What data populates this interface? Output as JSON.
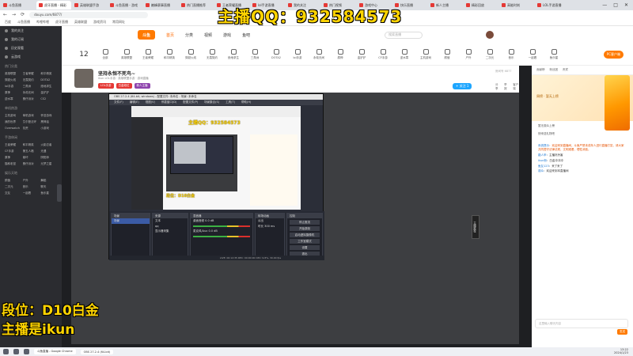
{
  "browser": {
    "tabs": [
      "斗鱼直播",
      "虎牙直播 - 精彩",
      "英雄联盟手游",
      "斗鱼直播 - 游戏",
      "巅峰赛事直播",
      "热门直播推荐",
      "王者荣耀直播",
      "lol手游直播",
      "我的关注",
      "热门视频",
      "游戏中心",
      "快乐直播",
      "新人主播",
      "精彩回放",
      "高能时刻",
      "LOL手游直播"
    ],
    "active_tab": 1,
    "url": "douyu.com/6877/",
    "bookmarks": [
      "百度",
      "斗鱼直播",
      "哔哩哔哩",
      "虎牙直播",
      "英雄联盟",
      "游戏资讯",
      "常用网址"
    ]
  },
  "overlay": {
    "qq": "主播QQ：932584573",
    "rank": "段位：D10白金",
    "host": "主播是ikun"
  },
  "sidebar": {
    "items": [
      "我的关注",
      "我的订阅",
      "历史观看",
      "云游戏"
    ],
    "sections": [
      {
        "title": "热门分类",
        "tags": [
          "英雄联盟",
          "王者荣耀",
          "和平精英",
          "穿越火线",
          "无畏契约",
          "DOTA2",
          "lol手游",
          "三角洲",
          "绝地求生",
          "原神",
          "永劫无间",
          "金铲铲",
          "逆水寒",
          "蛋仔派对",
          "CS2"
        ]
      },
      {
        "title": "单机热游",
        "tags": [
          "主机游戏",
          "单机游戏",
          "怀旧游戏",
          "我的世界",
          "艾尔登法环",
          "黑神话",
          "Overwatch",
          "饥荒",
          "小游戏"
        ]
      },
      {
        "title": "手游休闲",
        "tags": [
          "王者荣耀",
          "和平精英",
          "火影忍者",
          "CF手游",
          "第五人格",
          "光遇",
          "原神",
          "崩坏",
          "阴阳师",
          "猫和老鼠",
          "蛋仔派对",
          "元梦之星"
        ]
      },
      {
        "title": "娱乐天地",
        "tags": [
          "颜值",
          "户外",
          "舞蹈",
          "二次元",
          "音乐",
          "聊天",
          "交友",
          "一起看",
          "鱼乐星"
        ]
      }
    ]
  },
  "header": {
    "logo": "斗鱼",
    "nav": [
      "首页",
      "分类",
      "视频",
      "游戏",
      "鱼吧"
    ],
    "nav_active": 0,
    "search_placeholder": "搜索直播",
    "pc_client": "PC客户端"
  },
  "categories": {
    "count": "12",
    "items": [
      "全部",
      "英雄联盟",
      "王者荣耀",
      "和平精英",
      "穿越火线",
      "无畏契约",
      "绝地求生",
      "三角洲",
      "DOTA2",
      "lol手游",
      "永劫无间",
      "原神",
      "金铲铲",
      "CF手游",
      "逆水寒",
      "主机游戏",
      "颜值",
      "户外",
      "二次元",
      "音乐",
      "一起看",
      "鱼乐星"
    ]
  },
  "room": {
    "title": "坚持永恒不死鸟~",
    "meta": "ikun LOL手游 · 英雄联盟手游 · 游戏直播",
    "tags": [
      "LOL手游",
      "白金段位",
      "新人主播"
    ],
    "follow": "关注",
    "follow_count": "+ 关注 1",
    "room_id": "房间号 6877",
    "actions": [
      "分享",
      "举报",
      "客户端"
    ]
  },
  "player": {
    "side_label": "主播推荐"
  },
  "obs": {
    "title": "OBS 27.2.4 (64-bit, windows) - 配置文件: 未命名 - 场景: 未命名",
    "menu": [
      "文件(F)",
      "编辑(E)",
      "视图(V)",
      "停靠窗口(D)",
      "配置文件(P)",
      "场景集合(S)",
      "工具(T)",
      "帮助(H)"
    ],
    "preview_qq": "主播QQ：932584573",
    "preview_rank": "段位：D10白金",
    "docks": {
      "scenes": {
        "title": "场景",
        "items": [
          "场景"
        ]
      },
      "sources": {
        "title": "来源",
        "items": [
          "文本",
          "qq",
          "显示器采集"
        ]
      },
      "mixer": {
        "title": "混音器",
        "items": [
          "桌面音频 0.0 dB",
          "麦克风/Aux 0.0 dB"
        ]
      },
      "transitions": {
        "title": "转场动画",
        "items": [
          "淡出",
          "时长 300 ms"
        ]
      },
      "controls": {
        "title": "控制",
        "items": [
          "停止推流",
          "开始录制",
          "启动虚拟摄像机",
          "工作室模式",
          "设置",
          "退出"
        ]
      }
    },
    "status": "LIVE: 00:12:35   REC: 00:00:00   CPU: 9.8%, 30.00 fps"
  },
  "right_panel": {
    "tabs": [
      "贡献榜",
      "粉丝团",
      "贵宾"
    ],
    "rank_label": "周榜 · 暂无上榜",
    "rows": [
      "暂无观众上榜",
      "快来送礼物吧"
    ],
    "chat": [
      {
        "user": "系统提示",
        "text": "欢迎来到直播间，斗鱼严禁未成年人进行直播打赏，请大家共同遵守法律法规，文明观看，理性消费。",
        "notice": true
      },
      {
        "user": "路人甲",
        "text": "主播好厉害"
      },
      {
        "user": "ikun粉",
        "text": "白金冲冲冲"
      },
      {
        "user": "鱼友123",
        "text": "来了来了"
      },
      {
        "user": "观众",
        "text": "欢迎来到本直播间"
      }
    ],
    "input_placeholder": "这里输入聊天内容",
    "send": "发送"
  },
  "taskbar": {
    "apps": [
      "斗鱼直播 - Google Chrome",
      "OBS 27.2.4 (64-bit)"
    ],
    "time": "13:22",
    "date": "2024/1/23"
  },
  "colors": {
    "overlay_yellow": "#ffd400",
    "brand_orange": "#ff7a00",
    "player_bg": "#3d3e41"
  }
}
